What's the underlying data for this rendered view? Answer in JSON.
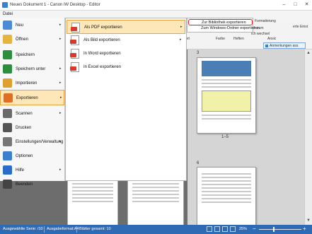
{
  "window": {
    "title": "Neues Dokument 1 - Canon iW Desktop - Editor",
    "minimize": "–",
    "maximize": "□",
    "close": "✕"
  },
  "menubar": {
    "file_tab": "Datei"
  },
  "ribbon": {
    "labels": [
      "Formatierung",
      "erte Einst",
      "Ich zum",
      "Ich wechsel",
      "Farbe",
      "Heften",
      "Ansic",
      "ort"
    ],
    "annotations_button": "Anmerkungen ass."
  },
  "backstage": {
    "items": [
      {
        "label": "Neu",
        "icon": "new-document-icon",
        "color": "#4a8ad8",
        "arrow": true
      },
      {
        "label": "Öffnen",
        "icon": "open-folder-icon",
        "color": "#e8b440",
        "arrow": true
      },
      {
        "label": "Speichern",
        "icon": "save-icon",
        "color": "#2a8e3a",
        "arrow": false
      },
      {
        "label": "Speichern unter",
        "icon": "save-as-icon",
        "color": "#2a8e3a",
        "arrow": true
      },
      {
        "label": "Importieren",
        "icon": "import-icon",
        "color": "#e0a030",
        "arrow": true
      },
      {
        "label": "Exportieren",
        "icon": "export-icon",
        "color": "#e07020",
        "arrow": true,
        "active": true
      },
      {
        "label": "Scannen",
        "icon": "scanner-icon",
        "color": "#6b6b6b",
        "arrow": true
      },
      {
        "label": "Drucken",
        "icon": "printer-icon",
        "color": "#555555",
        "arrow": false
      },
      {
        "label": "Einstellungen/Verwaltung",
        "icon": "gear-icon",
        "color": "#777777",
        "arrow": true
      },
      {
        "label": "Optionen",
        "icon": "options-icon",
        "color": "#3a7fd0",
        "arrow": false
      },
      {
        "label": "Hilfe",
        "icon": "help-icon",
        "color": "#2a6cc8",
        "arrow": true
      },
      {
        "label": "Beenden",
        "icon": "close-icon",
        "color": "#444444",
        "arrow": false
      }
    ]
  },
  "submenu": {
    "items": [
      {
        "label": "Als PDF exportieren",
        "icon": "pdf-file-icon",
        "tag_color": "#d63a2a",
        "arrow": true,
        "active": true
      },
      {
        "label": "Als Bild exportieren",
        "icon": "image-file-icon",
        "tag_color": "#d63a2a",
        "arrow": true
      },
      {
        "label": "In Word exportieren",
        "icon": "word-file-icon",
        "tag_color": "#d63a2a",
        "arrow": false
      },
      {
        "label": "In Excel exportieren",
        "icon": "excel-file-icon",
        "tag_color": "#d63a2a",
        "arrow": false
      }
    ]
  },
  "subsubmenu": {
    "items": [
      {
        "label": "Zur Bibliothek exportieren",
        "highlight": true
      },
      {
        "label": "Zum Windows-Ordner exportieren",
        "highlight": false
      }
    ]
  },
  "document": {
    "page_label_top": "3",
    "page_range": "1–5",
    "page_label_bottom": "6"
  },
  "statusbar": {
    "selection": "Ausgewählte Serie: /10",
    "format": "Ausgabeformat:A4",
    "sheets": "Blätter gesamt: 10",
    "zoom": "25%",
    "zoom_value": 0.25
  },
  "colors": {
    "accent": "#2f6bb4",
    "active_bg": "#fde7b8",
    "active_border": "#e8a33c",
    "highlight_border": "#e02020"
  }
}
